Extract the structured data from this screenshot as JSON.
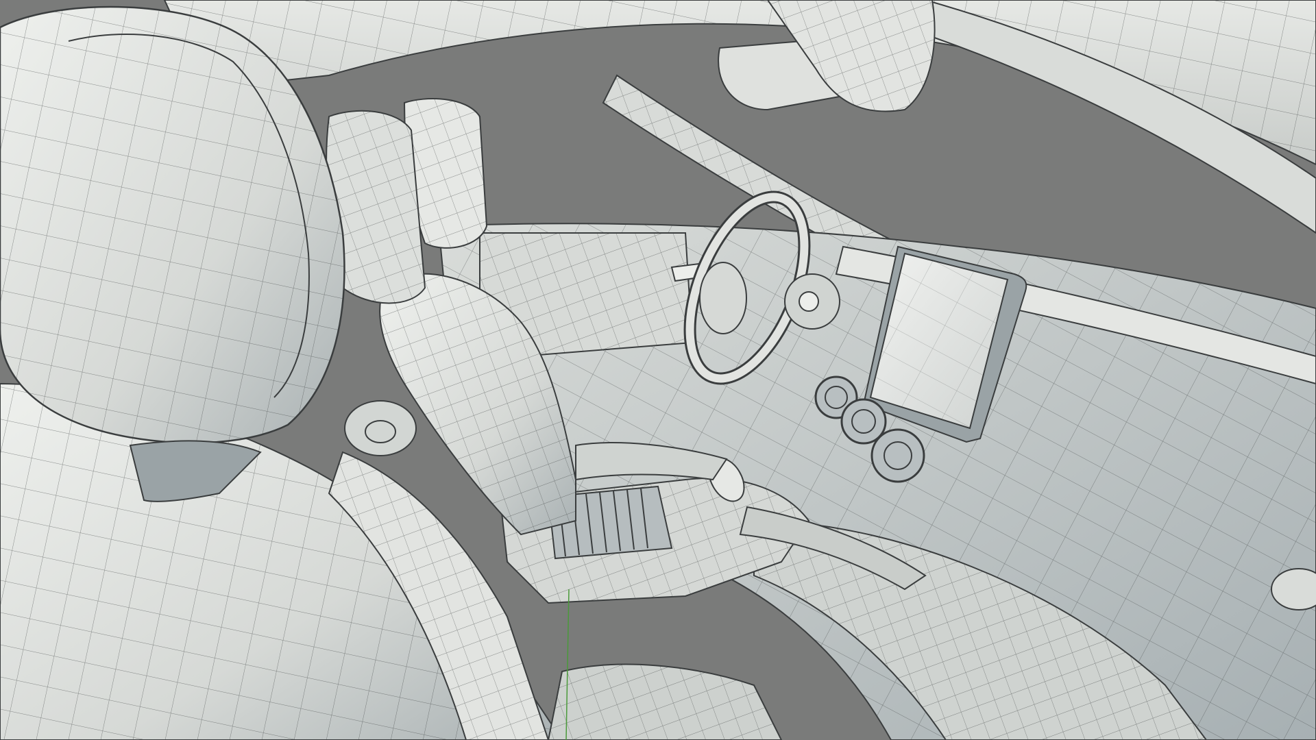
{
  "scene": {
    "subject": "car-interior-wireframe-render",
    "view": "3d-viewport",
    "colors": {
      "background": "#7a7b7a",
      "surface_light": "#e6e8e5",
      "surface_mid": "#c9ccc9",
      "surface_shadow": "#9aa3a6",
      "wire": "#3a3d3e",
      "wire_light": "#6b7072",
      "axis_green": "#4a9a3a"
    },
    "icons": {
      "driver_seat": "seat-icon",
      "passenger_seat": "seat-icon",
      "steering_wheel": "steering-wheel-icon",
      "infotainment_screen": "display-icon",
      "air_vents": "vent-icon",
      "rearview_mirror": "mirror-icon"
    }
  }
}
